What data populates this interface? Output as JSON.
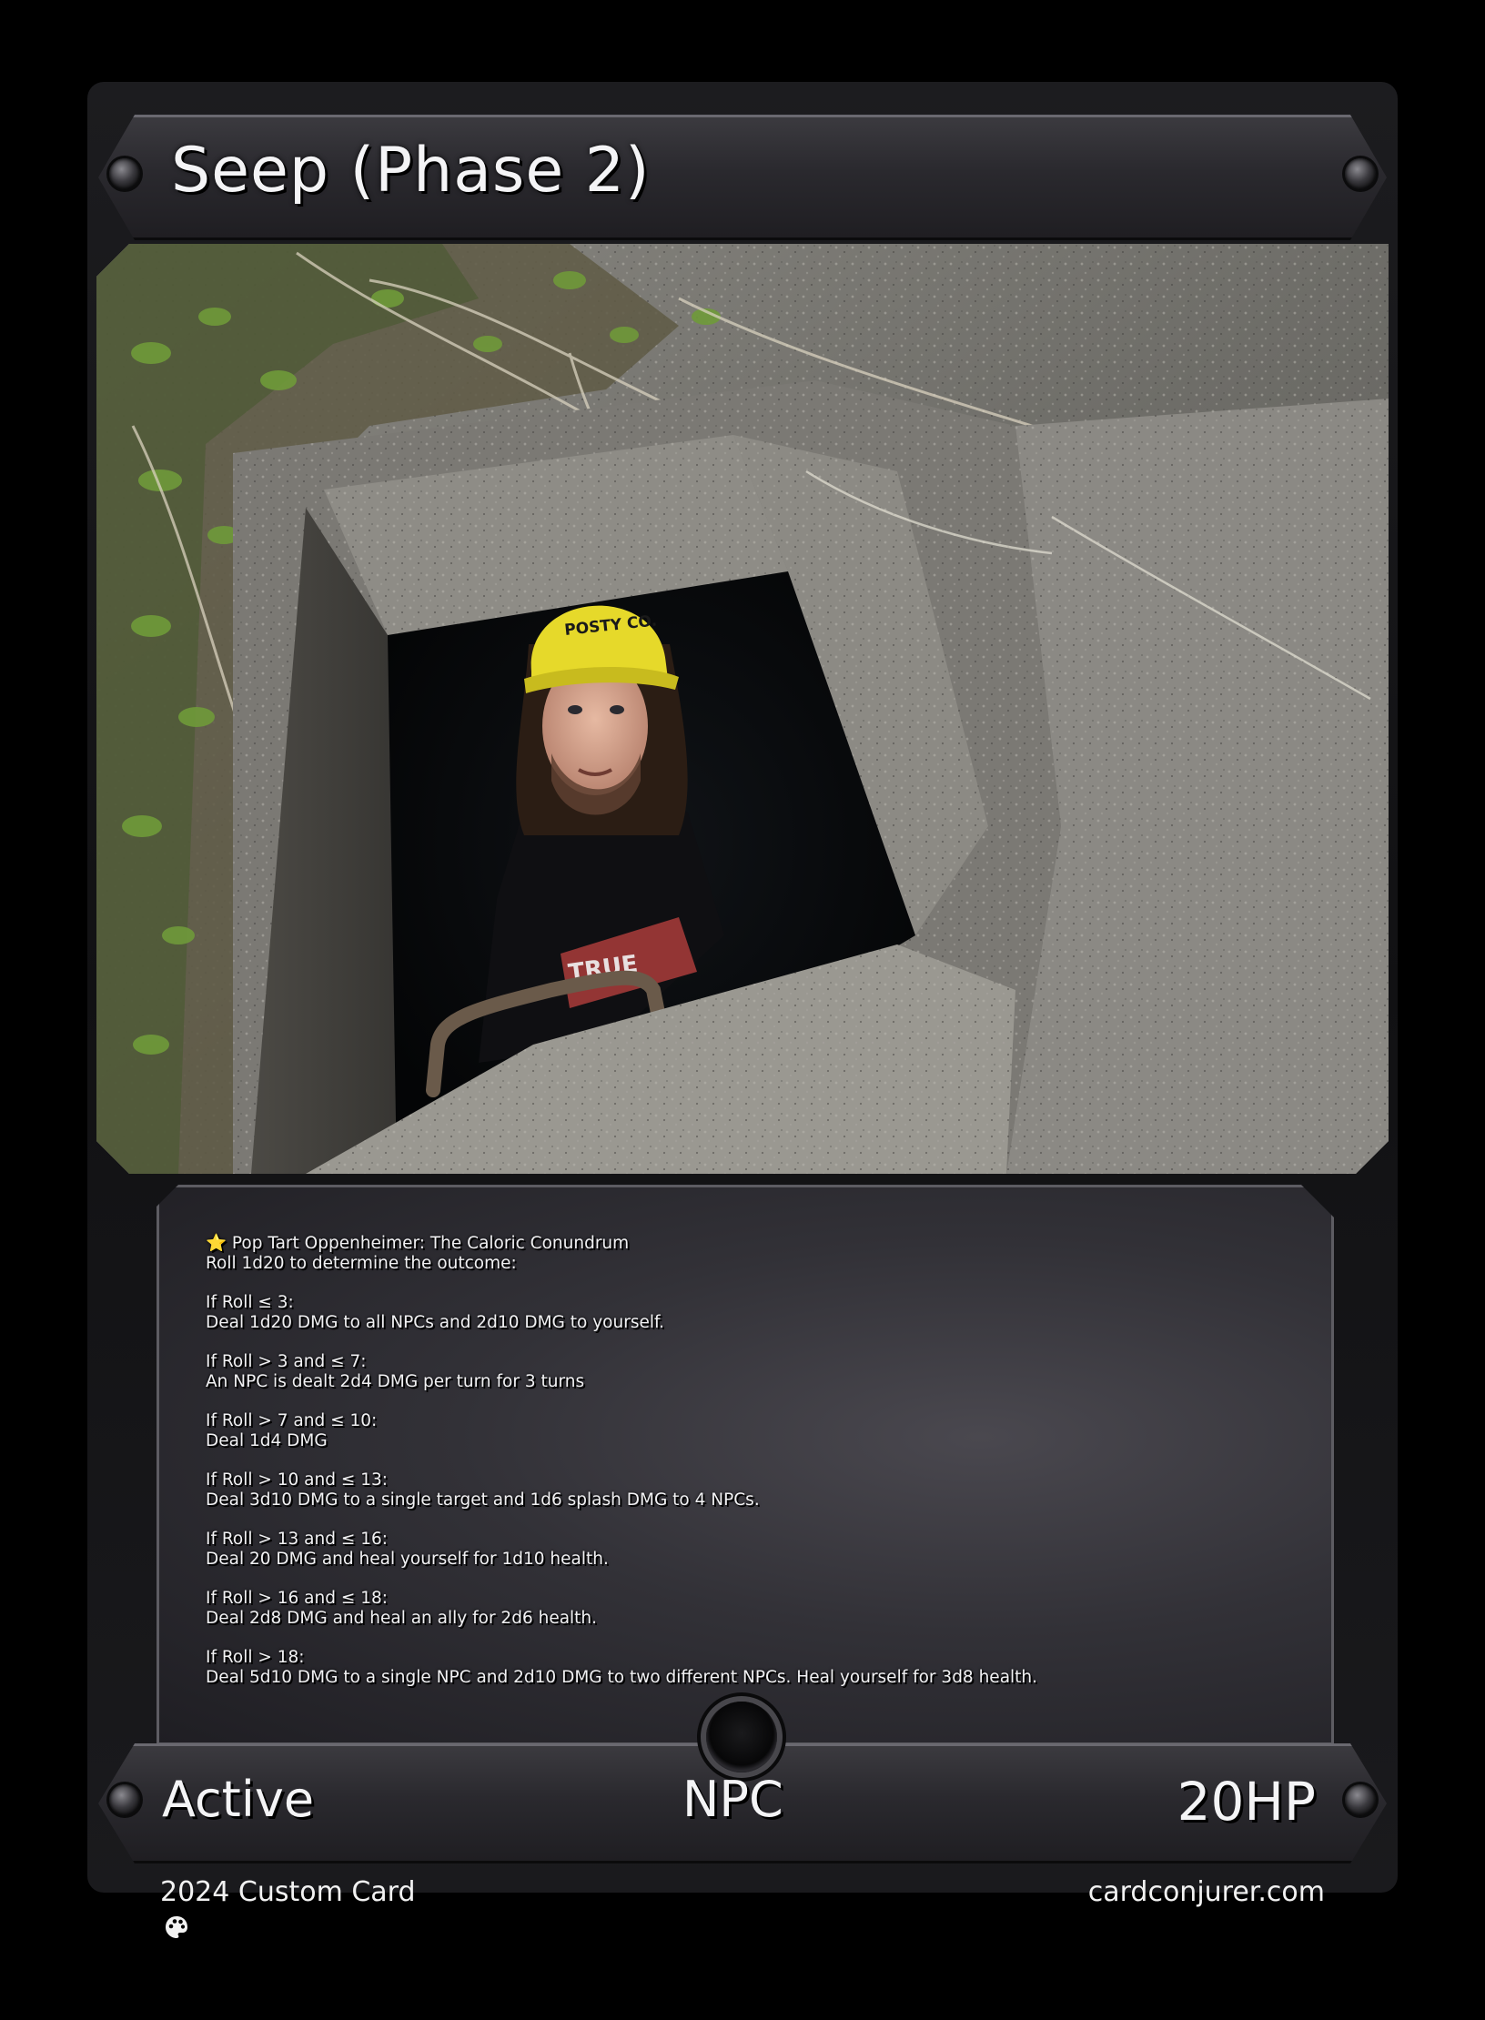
{
  "card": {
    "title": "Seep (Phase 2)",
    "ability": [
      [
        "⭐ Pop Tart Oppenheimer: The Caloric Conundrum",
        "Roll 1d20 to determine the outcome:"
      ],
      [
        "If Roll ≤ 3:",
        "Deal 1d20 DMG to all NPCs and 2d10 DMG to yourself."
      ],
      [
        "If Roll > 3 and ≤ 7:",
        "An NPC is dealt 2d4 DMG per turn for 3 turns"
      ],
      [
        "If Roll > 7 and ≤ 10:",
        "Deal 1d4 DMG"
      ],
      [
        "If Roll > 10 and ≤ 13:",
        "Deal 3d10 DMG to a single target and 1d6 splash DMG to 4 NPCs."
      ],
      [
        "If Roll > 13 and ≤ 16:",
        "Deal 20 DMG and heal yourself for 1d10 health."
      ],
      [
        "If Roll > 16 and ≤ 18:",
        "Deal 2d8 DMG and heal an ally for 2d6 health."
      ],
      [
        "If Roll > 18:",
        "Deal 5d10 DMG to a single NPC and 2d10 DMG to two different NPCs. Heal yourself for 3d8 health."
      ]
    ],
    "status": "Active",
    "type": "NPC",
    "hp": "20HP"
  },
  "credits": {
    "left": "2024 Custom Card",
    "right": "cardconjurer.com",
    "icon": "palette-icon"
  },
  "art": {
    "cap_text": "POSTY CO.",
    "shirt_text": "TRUE"
  },
  "colors": {
    "frame": "#111113",
    "plate": "#2a292e",
    "text": "#f4f4f6",
    "cap": "#e6d92a"
  }
}
